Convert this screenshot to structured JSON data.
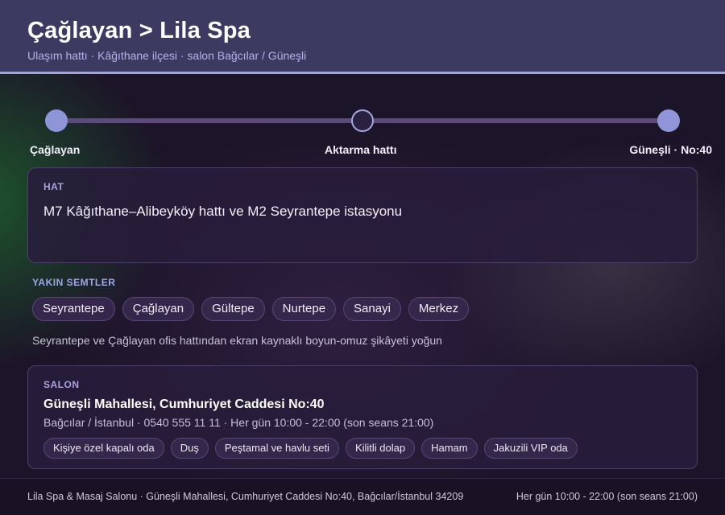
{
  "header": {
    "title": "Çağlayan > Lila Spa",
    "subtitle": "Ulaşım hattı · Kâğıthane ilçesi · salon Bağcılar / Güneşli"
  },
  "route": {
    "steps": [
      {
        "label": "Çağlayan",
        "state": "filled"
      },
      {
        "label": "Aktarma hattı",
        "state": "hollow"
      },
      {
        "label": "Güneşli · No:40",
        "state": "filled"
      }
    ]
  },
  "hat": {
    "label": "HAT",
    "value": "M7 Kâğıthane–Alibeyköy hattı ve M2 Seyrantepe istasyonu"
  },
  "semtler": {
    "label": "YAKIN SEMTLER",
    "items": [
      "Seyrantepe",
      "Çağlayan",
      "Gültepe",
      "Nurtepe",
      "Sanayi",
      "Merkez"
    ],
    "note": "Seyrantepe ve Çağlayan ofis hattından ekran kaynaklı boyun-omuz şikâyeti yoğun"
  },
  "salon": {
    "label": "SALON",
    "address": "Güneşli Mahallesi, Cumhuriyet Caddesi No:40",
    "meta": "Bağcılar / İstanbul · 0540 555 11 11 · Her gün 10:00 - 22:00 (son seans 21:00)",
    "amenities": [
      "Kişiye özel kapalı oda",
      "Duş",
      "Peştamal ve havlu seti",
      "Kilitli dolap",
      "Hamam",
      "Jakuzili VIP oda"
    ]
  },
  "footer": {
    "left": "Lila Spa & Masaj Salonu · Güneşli Mahallesi, Cumhuriyet Caddesi No:40, Bağcılar/İstanbul 34209",
    "right": "Her gün 10:00 - 22:00 (son seans 21:00)"
  },
  "colors": {
    "header_bg": "#3d3a62",
    "accent": "#9ea4e0",
    "node_filled": "#8f95d6",
    "background": "#1c1428"
  }
}
